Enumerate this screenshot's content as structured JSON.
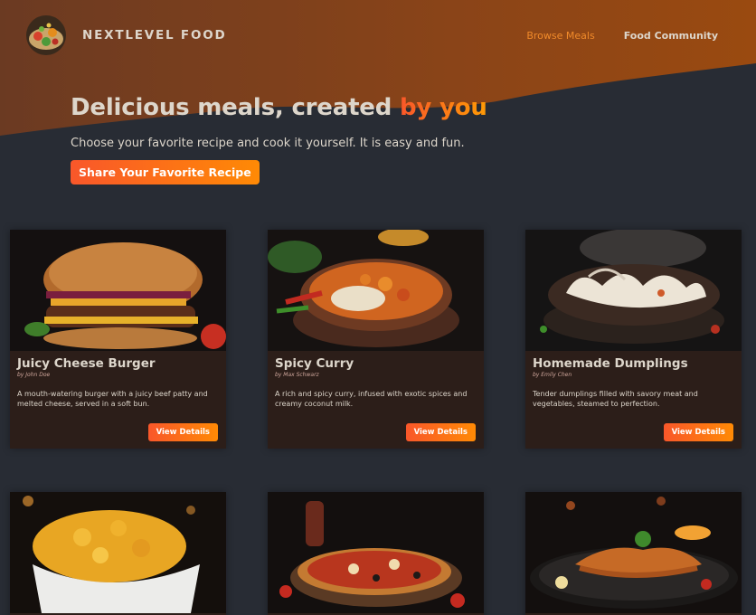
{
  "header": {
    "logo_text": "NEXTLEVEL FOOD",
    "nav": [
      {
        "label": "Browse Meals",
        "active": true
      },
      {
        "label": "Food Community",
        "active": false
      }
    ]
  },
  "hero": {
    "title_main": "Delicious meals, created ",
    "title_accent": "by you",
    "subtitle": "Choose your favorite recipe and cook it yourself. It is easy and fun.",
    "cta_label": "Share Your Favorite Recipe"
  },
  "meals": [
    {
      "title": "Juicy Cheese Burger",
      "creator": "by John Doe",
      "summary": "A mouth-watering burger with a juicy beef patty and melted cheese, served in a soft bun.",
      "action": "View Details",
      "image_icon": "burger-image"
    },
    {
      "title": "Spicy Curry",
      "creator": "by Max Schwarz",
      "summary": "A rich and spicy curry, infused with exotic spices and creamy coconut milk.",
      "action": "View Details",
      "image_icon": "curry-image"
    },
    {
      "title": "Homemade Dumplings",
      "creator": "by Emily Chen",
      "summary": "Tender dumplings filled with savory meat and vegetables, steamed to perfection.",
      "action": "View Details",
      "image_icon": "dumplings-image"
    },
    {
      "image_icon": "mac-and-cheese-image"
    },
    {
      "image_icon": "pizza-image"
    },
    {
      "image_icon": "schnitzel-image"
    }
  ],
  "colors": {
    "background": "#282c34",
    "accent_start": "#f9572a",
    "accent_end": "#ff9b05",
    "card": "#2c1e19",
    "text": "#ddd6cb"
  }
}
